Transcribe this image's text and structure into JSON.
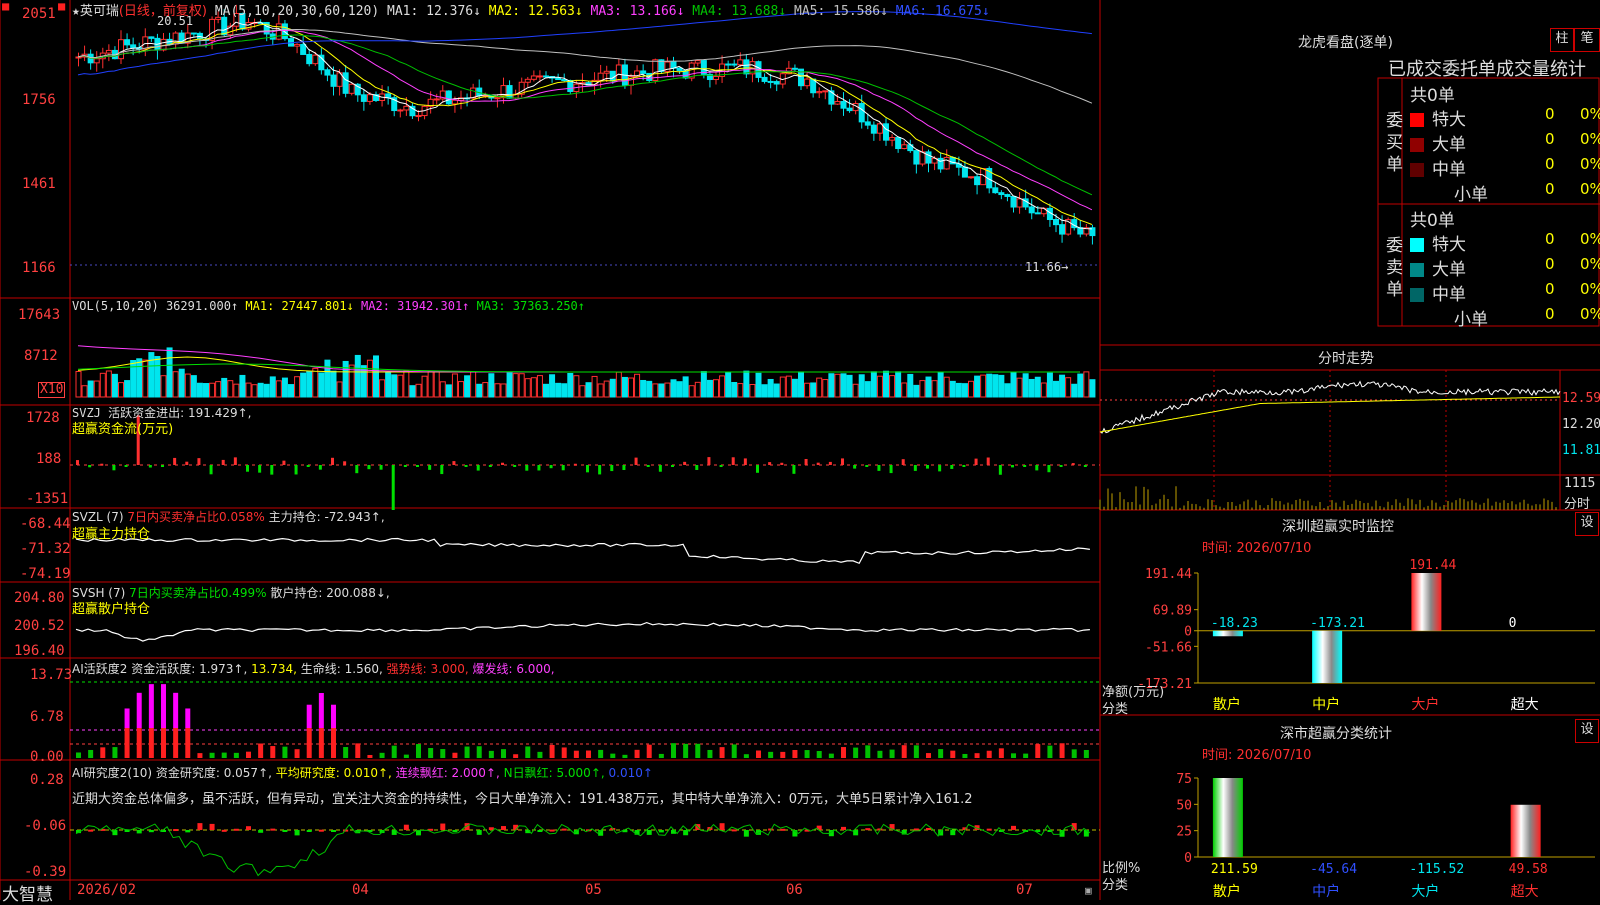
{
  "colors": {
    "up": "#ff3030",
    "down": "#00e5ee",
    "grid": "#c00000",
    "axis": "#ff4040",
    "ma1": "#ffffff",
    "ma2": "#ffff00",
    "ma3": "#ff40ff",
    "ma4": "#00c000",
    "ma5": "#c0c0c0",
    "ma6": "#2040ff"
  },
  "main": {
    "title_star": "★",
    "stock_name": "英可瑞",
    "period": "(日线，前复权)",
    "ma_label": "MA(5,10,20,30,60,120)",
    "ma_values": [
      "MA1: 12.376↓",
      "MA2: 12.563↓",
      "MA3: 13.166↓",
      "MA4: 13.688↓",
      "MA5: 15.586↓",
      "MA6: 16.675↓"
    ],
    "high_mark": "20.51",
    "low_mark": "11.66→",
    "y_ticks": [
      "2051",
      "1756",
      "1461",
      "1166"
    ]
  },
  "vol": {
    "label": "VOL(5,10,20)",
    "v": "36291.000↑",
    "ma1": "MA1: 27447.801↓",
    "ma2": "MA2: 31942.301↑",
    "ma3": "MA3: 37363.250↑",
    "y_ticks": [
      "17643",
      "8712"
    ],
    "scale": "X10"
  },
  "svzj": {
    "label": "SVZJ",
    "text1": "活跃资金进出: 191.429↑,",
    "text2": "超赢资金流(万元)",
    "y_ticks": [
      "1728",
      "188",
      "-1351"
    ]
  },
  "svzl": {
    "label": "SVZL (7)",
    "text1": "7日内买卖净占比0.058%",
    "text2": "主力持仓: -72.943↑,",
    "text3": "超赢主力持仓",
    "y_ticks": [
      "-68.44",
      "-71.32",
      "-74.19"
    ]
  },
  "svsh": {
    "label": "SVSH (7)",
    "text1": "7日内买卖净占比0.499%",
    "text2": "散户持仓: 200.088↓,",
    "text3": "超赢散户持仓",
    "y_ticks": [
      "204.80",
      "200.52",
      "196.40"
    ]
  },
  "ai1": {
    "label": "AI活跃度2",
    "t1": "资金活跃度: 1.973↑,",
    "t2": "13.734,",
    "t3": "生命线: 1.560,",
    "t4": "强势线: 3.000,",
    "t5": "爆发线: 6.000,",
    "y_ticks": [
      "13.73",
      "6.78",
      "0.00"
    ]
  },
  "ai2": {
    "label": "AI研究度2(10)",
    "t1": "资金研究度: 0.057↑,",
    "t2": "平均研究度: 0.010↑,",
    "t3": "连续飘红: 2.000↑,",
    "t4": "N日飘红: 5.000↑,",
    "t5": "0.010↑",
    "note": "近期大资金总体偏多，虽不活跃，但有异动，宜关注大资金的持续性，今日大单净流入：191.438万元，其中特大单净流入：0万元，大单5日累计净入161.2",
    "y_ticks": [
      "0.28",
      "-0.06",
      "-0.39"
    ]
  },
  "xaxis": {
    "labels": [
      "2026/02",
      "04",
      "05",
      "06",
      "07"
    ],
    "brand": "大智慧"
  },
  "longhu": {
    "title": "龙虎看盘(逐单)",
    "btn1": "柱",
    "btn2": "笔",
    "subtitle": "已成交委托单成交量统计",
    "buy_label": "委买单",
    "sell_label": "委卖单",
    "buy_total": "共0单",
    "sell_total": "共0单",
    "buy_rows": [
      {
        "name": "特大",
        "v": "0",
        "p": "0%",
        "color": "#ff0000"
      },
      {
        "name": "大单",
        "v": "0",
        "p": "0%",
        "color": "#900000"
      },
      {
        "name": "中单",
        "v": "0",
        "p": "0%",
        "color": "#600000"
      },
      {
        "name": "小单",
        "v": "0",
        "p": "0%",
        "color": ""
      }
    ],
    "sell_rows": [
      {
        "name": "特大",
        "v": "0",
        "p": "0%",
        "color": "#00ffff"
      },
      {
        "name": "大单",
        "v": "0",
        "p": "0%",
        "color": "#008888"
      },
      {
        "name": "中单",
        "v": "0",
        "p": "0%",
        "color": "#006666"
      },
      {
        "name": "小单",
        "v": "0",
        "p": "0%",
        "color": ""
      }
    ]
  },
  "fenshi": {
    "title": "分时走势",
    "y_ticks": [
      "12.59",
      "12.20",
      "11.81"
    ],
    "vol_tick": "1115",
    "vol_unit": "分时"
  },
  "sz_monitor": {
    "title": "深圳超赢实时监控",
    "btn": "设",
    "date": "时间: 2026/07/10",
    "y_ticks": [
      "191.44",
      "69.89",
      "0",
      "-51.66",
      "-173.21"
    ],
    "unit": "净额(万元)",
    "cat_label": "分类"
  },
  "sz_stats": {
    "title": "深市超赢分类统计",
    "btn": "设",
    "date": "时间: 2026/07/10",
    "y_ticks": [
      "75",
      "50",
      "25",
      "0"
    ],
    "unit": "比例%",
    "cat_label": "分类"
  },
  "chart_data": [
    {
      "type": "bar",
      "title": "深圳超赢实时监控",
      "categories": [
        "散户",
        "中户",
        "大户",
        "超大"
      ],
      "values": [
        -18.23,
        -173.21,
        191.44,
        0
      ],
      "ylabel": "净额(万元)",
      "ylim": [
        -173.21,
        191.44
      ]
    },
    {
      "type": "bar",
      "title": "深市超赢分类统计",
      "categories": [
        "散户",
        "中户",
        "大户",
        "超大"
      ],
      "values": [
        211.59,
        -45.64,
        -115.52,
        49.58
      ],
      "ylabel": "比例%",
      "ylim": [
        0,
        75
      ]
    }
  ]
}
